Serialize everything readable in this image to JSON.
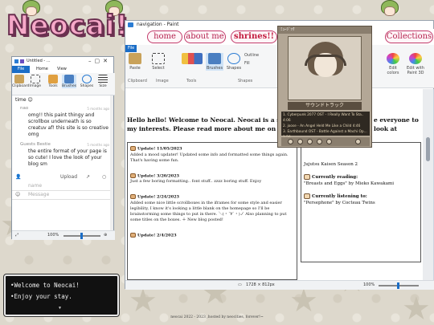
{
  "logo": {
    "text": "Neocai!"
  },
  "nav_window": {
    "title": "navigation - Paint",
    "links": [
      "home",
      "about me",
      "shrines!!",
      "Collections"
    ],
    "file_tab": "File",
    "ribbon": {
      "paste": "Paste",
      "select": "Select",
      "brushes": "Brushes",
      "shapes": "Shapes",
      "outline": "Outline",
      "fill": "Fill",
      "edit_colors": "Edit colors",
      "edit_paint3d": "Edit with Paint 3D"
    },
    "groups": {
      "clipboard": "Clipboard",
      "image": "Image",
      "tools": "Tools",
      "shapes": "Shapes"
    },
    "hello": "Hello hello! Welcome to Neocai. Neocai is a space whe",
    "hello2": "my interests. Please read more about me on the about",
    "hello3": "e everyone to look at",
    "updates": [
      {
        "title": "Update! 11/05/2023",
        "body": "Added a mood updater! Updated some info and formatted some things again. That's having some fun."
      },
      {
        "title": "Update! 3/20/2023",
        "body": "Just a few boring formatting.. font stuff.. zzzz boring stuff. Enjoy"
      },
      {
        "title": "Update! 2/24/2023",
        "body": "Added some nice little scrollboxes in the iframes for some style and easier legibility, I know it's looking a little blank on the homepage so I'll be brainstorming some things to put in there. ＼(・´∀`・)ノ Also planning to put some titles on the boxes. ＋ New blog posted!"
      },
      {
        "title": "Update! 2/4/2023",
        "body": ""
      }
    ],
    "side": {
      "watching_line": "Jujutsu Kaisen Season 2",
      "reading_head": "Currently reading:",
      "reading": "\"Breasts and Eggs\" by Mieko Kawakami",
      "listening_head": "Currently listening to:",
      "listening": "\"Persephone\" by Cocteau Twins"
    },
    "status": {
      "size": "1728 × 812px",
      "zoom": "100%"
    }
  },
  "player": {
    "title": "ﾐｭｰｼﾞｯｸ",
    "name": "サウンドトラック",
    "playlist": [
      "1. Cyberpunk 2077 OST - I Really Want To Sta.. 4:06",
      "2. joose - An Angel Held Me Like a Child 4:46",
      "3. Earthbound OST - Battle Against a Machi Op... 1:56"
    ]
  },
  "paint_window": {
    "title": "Untitled - ...",
    "tabs": [
      "File",
      "Home",
      "View"
    ],
    "tools": [
      "Clipboard",
      "Image",
      "Tools",
      "Brushes",
      "Shapes",
      "Size"
    ],
    "messages": [
      {
        "text": "time 😊"
      },
      {
        "name": "nao",
        "date": "5 months ago",
        "text": "omg!! this paint thingy and scrollbox underneath is so creatuv af! this site is so creative omg"
      },
      {
        "name": "Guests Bestie",
        "date": "5 months ago",
        "text": "the entire format of your page is so cute! I love the look of your blog sm"
      }
    ],
    "upload": "Upload",
    "name_placeholder": "name",
    "message_placeholder": "Message",
    "zoom": "100%"
  },
  "dialog": {
    "line1": "•Welcome to Neocai!",
    "line2": "•Enjoy your stay."
  },
  "footer": "neocai 2022 - 2023 ,hosted by neocities, forever!~"
}
